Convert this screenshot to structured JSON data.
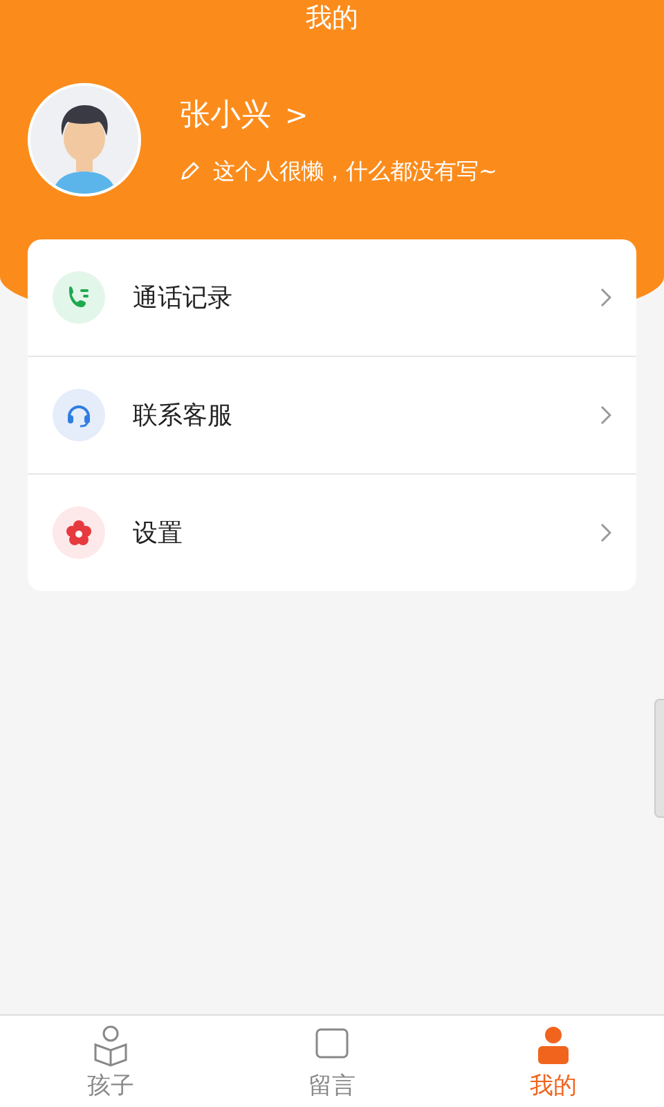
{
  "header": {
    "title": "我的"
  },
  "profile": {
    "name": "张小兴",
    "chevron": ">",
    "bio": "这个人很懒，什么都没有写~"
  },
  "menu": [
    {
      "kind": "phone",
      "label": "通话记录"
    },
    {
      "kind": "headset",
      "label": "联系客服"
    },
    {
      "kind": "settings",
      "label": "设置"
    }
  ],
  "tabs": [
    {
      "kind": "child",
      "label": "孩子",
      "selected": false
    },
    {
      "kind": "message",
      "label": "留言",
      "selected": false
    },
    {
      "kind": "me",
      "label": "我的",
      "selected": true
    }
  ]
}
